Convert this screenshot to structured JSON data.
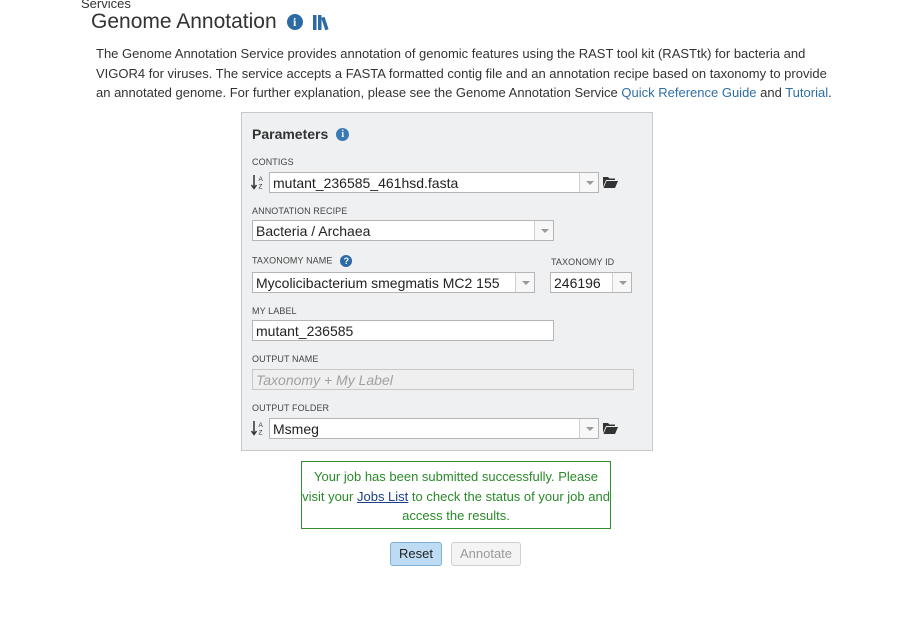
{
  "breadcrumb": "Services",
  "page": {
    "title": "Genome Annotation",
    "description_prefix": "The Genome Annotation Service provides annotation of genomic features using the RAST tool kit (RASTtk) for bacteria and VIGOR4 for viruses. The service accepts a FASTA formatted contig file and an annotation recipe based on taxonomy to provide an annotated genome. For further explanation, please see the Genome Annotation Service ",
    "guide_link": "Quick Reference Guide",
    "and_text": " and ",
    "tutorial_link": "Tutorial",
    "period": "."
  },
  "parameters": {
    "header": "Parameters",
    "contigs": {
      "label": "CONTIGS",
      "value": "mutant_236585_461hsd.fasta"
    },
    "recipe": {
      "label": "ANNOTATION RECIPE",
      "value": "Bacteria / Archaea"
    },
    "taxonomy_name": {
      "label": "TAXONOMY NAME",
      "value": "Mycolicibacterium smegmatis MC2 155"
    },
    "taxonomy_id": {
      "label": "TAXONOMY ID",
      "value": "246196"
    },
    "my_label": {
      "label": "MY LABEL",
      "value": "mutant_236585"
    },
    "output_name": {
      "label": "OUTPUT NAME",
      "placeholder": "Taxonomy + My Label"
    },
    "output_folder": {
      "label": "OUTPUT FOLDER",
      "value": "Msmeg"
    }
  },
  "message": {
    "prefix": "Your job has been submitted successfully. Please visit your ",
    "link": "Jobs List",
    "suffix": " to check the status of your job and access the results."
  },
  "buttons": {
    "reset": "Reset",
    "annotate": "Annotate"
  },
  "colors": {
    "accent": "#2e6fa7",
    "success": "#2a8a2a",
    "panel_bg": "#eff0f1"
  }
}
